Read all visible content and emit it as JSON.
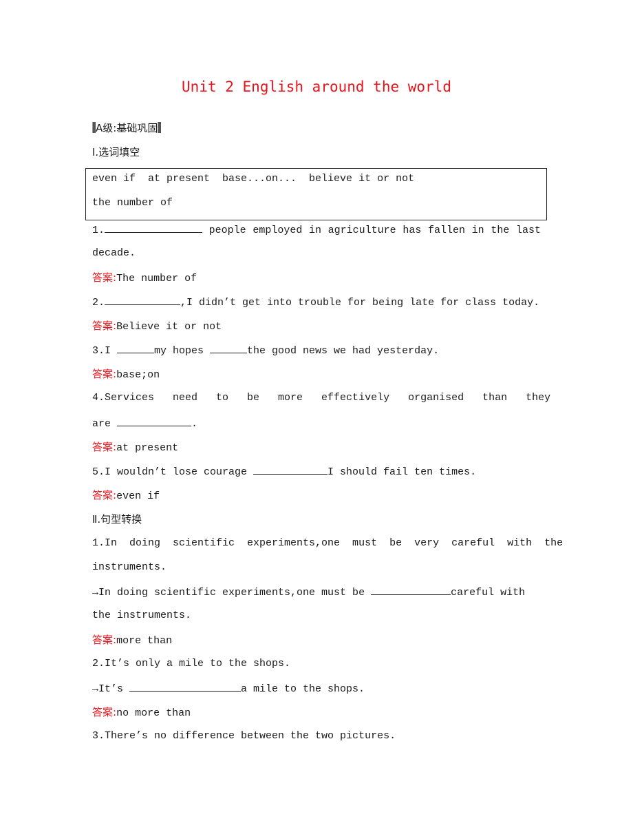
{
  "title": "Unit 2  English around the world",
  "level_heading": "A级:基础巩固",
  "section1": {
    "heading": "Ⅰ.选词填空",
    "word_box": {
      "row1": "even if  at present  base...on...  believe it or not",
      "row2": "the number of"
    },
    "answer_label": "答案:",
    "items": [
      {
        "num": "1.",
        "after_blank": " people employed in agriculture has fallen in the last",
        "line2": "decade.",
        "answer": "The number of"
      },
      {
        "num": "2.",
        "after_blank": ",I didn’t get into trouble for being late for class today.",
        "answer": "Believe it or not"
      },
      {
        "prefix": "3.I ",
        "mid": "my hopes ",
        "after_blank": "the good news we had yesterday.",
        "answer": "base;on"
      },
      {
        "line1": "4.Services   need   to   be   more   effectively   organised   than   they",
        "line2_prefix": "are ",
        "line2_suffix": ".",
        "answer": "at present"
      },
      {
        "prefix": "5.I wouldn’t lose courage ",
        "after_blank": "I should fail ten times.",
        "answer": "even if"
      }
    ]
  },
  "section2": {
    "heading": "Ⅱ.句型转换",
    "items": [
      {
        "line1": "1.In  doing  scientific  experiments,one  must  be  very  careful  with  the",
        "line2": "instruments.",
        "rewrite_prefix": "→In doing scientific experiments,one must be ",
        "rewrite_suffix": "careful with",
        "rewrite_line2": "the instruments.",
        "answer": "more than"
      },
      {
        "line1": "2.It’s only a mile to the shops.",
        "rewrite_prefix": "→It’s ",
        "rewrite_suffix": "a mile to the shops.",
        "answer": "no more than"
      },
      {
        "line1": "3.There’s no difference between the two pictures."
      }
    ]
  }
}
